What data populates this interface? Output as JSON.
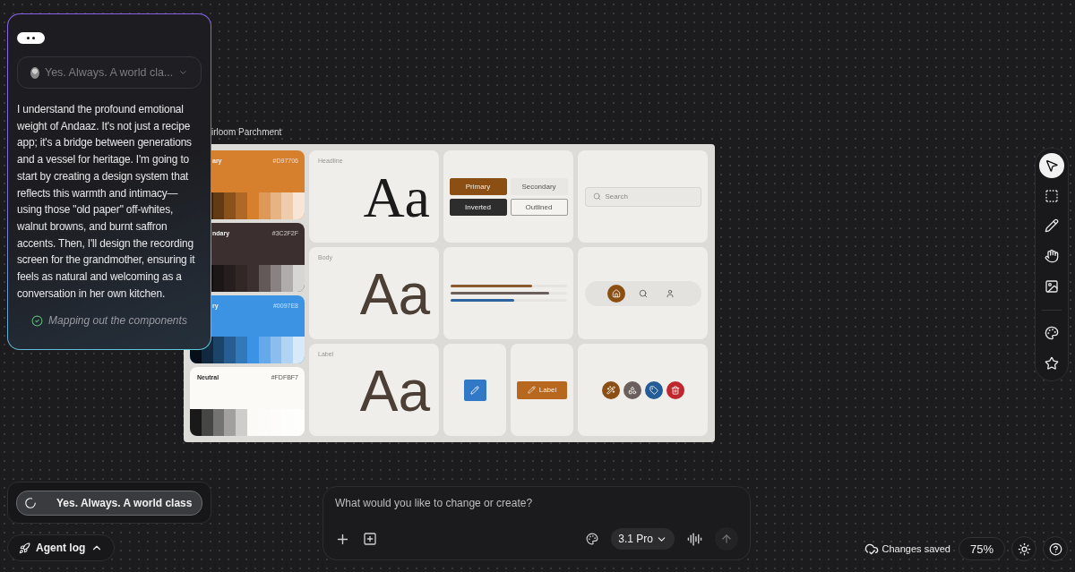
{
  "chat_panel": {
    "selector": {
      "text": "Yes. Always. A world cla..."
    },
    "message": "I understand the profound emotional weight of Andaaz. It's not just a recipe app; it's a bridge between generations and a vessel for heritage. I'm going to start by creating a design system that reflects this warmth and intimacy—using those \"old paper\" off-whites, walnut browns, and burnt saffron accents. Then, I'll design the recording screen for the grandmother, ensuring it feels as natural and welcoming as a conversation in her own kitchen.",
    "status": {
      "text": "Mapping out the components",
      "done": true
    }
  },
  "board": {
    "title": "irloom Parchment",
    "palettes": [
      {
        "name": "ary",
        "hex": "#D97706",
        "color": "#d6802e"
      },
      {
        "name": "ndary",
        "hex": "#3C2F2F",
        "color": "#3c2f2f"
      },
      {
        "name": "ry",
        "hex": "#0097E8",
        "color": "#3d93e3"
      },
      {
        "name": "Neutral",
        "hex": "#FDFBF7",
        "color": "#fbfaf7"
      }
    ],
    "type_samples": [
      {
        "label": "Headline",
        "sample": "Aa",
        "kind": "serif"
      },
      {
        "label": "Body",
        "sample": "Aa",
        "kind": "sans"
      },
      {
        "label": "Label",
        "sample": "Aa",
        "kind": "sans"
      }
    ],
    "buttons": [
      {
        "label": "Primary",
        "kind": "primary"
      },
      {
        "label": "Secondary",
        "kind": "secondary"
      },
      {
        "label": "Inverted",
        "kind": "inverted"
      },
      {
        "label": "Outlined",
        "kind": "outlined"
      }
    ],
    "search": {
      "placeholder": "Search"
    },
    "progress": [
      {
        "level": 0.7,
        "color": "#8b5a2b"
      },
      {
        "level": 0.85,
        "color": "#6b5f5c"
      },
      {
        "level": 0.55,
        "color": "#2e64a0"
      }
    ],
    "nav": [
      {
        "kind": "home",
        "selected": true
      },
      {
        "kind": "search",
        "selected": false
      },
      {
        "kind": "person",
        "selected": false
      }
    ],
    "label_button": {
      "label": "Label"
    },
    "icon_chips": [
      {
        "kind": "wand",
        "color": "#8b4f14"
      },
      {
        "kind": "shapes",
        "color": "#6a5f5d"
      },
      {
        "kind": "tag",
        "color": "#245c96"
      },
      {
        "kind": "trash",
        "color": "#c0272d"
      }
    ]
  },
  "toolbar": [
    {
      "kind": "pointer",
      "selected": true
    },
    {
      "kind": "select",
      "selected": false
    },
    {
      "kind": "pencil",
      "selected": false
    },
    {
      "kind": "hand",
      "selected": false
    },
    {
      "kind": "image",
      "selected": false
    },
    {
      "kind": "divider"
    },
    {
      "kind": "palette",
      "selected": false
    },
    {
      "kind": "star",
      "selected": false
    }
  ],
  "progress_pill": {
    "text": "Yes. Always. A world class"
  },
  "agent_log": {
    "label": "Agent log"
  },
  "prompt": {
    "placeholder": "What would you like to change or create?",
    "model": "3.1 Pro"
  },
  "status_bar": {
    "save_status": "Changes saved",
    "zoom": "75%"
  }
}
